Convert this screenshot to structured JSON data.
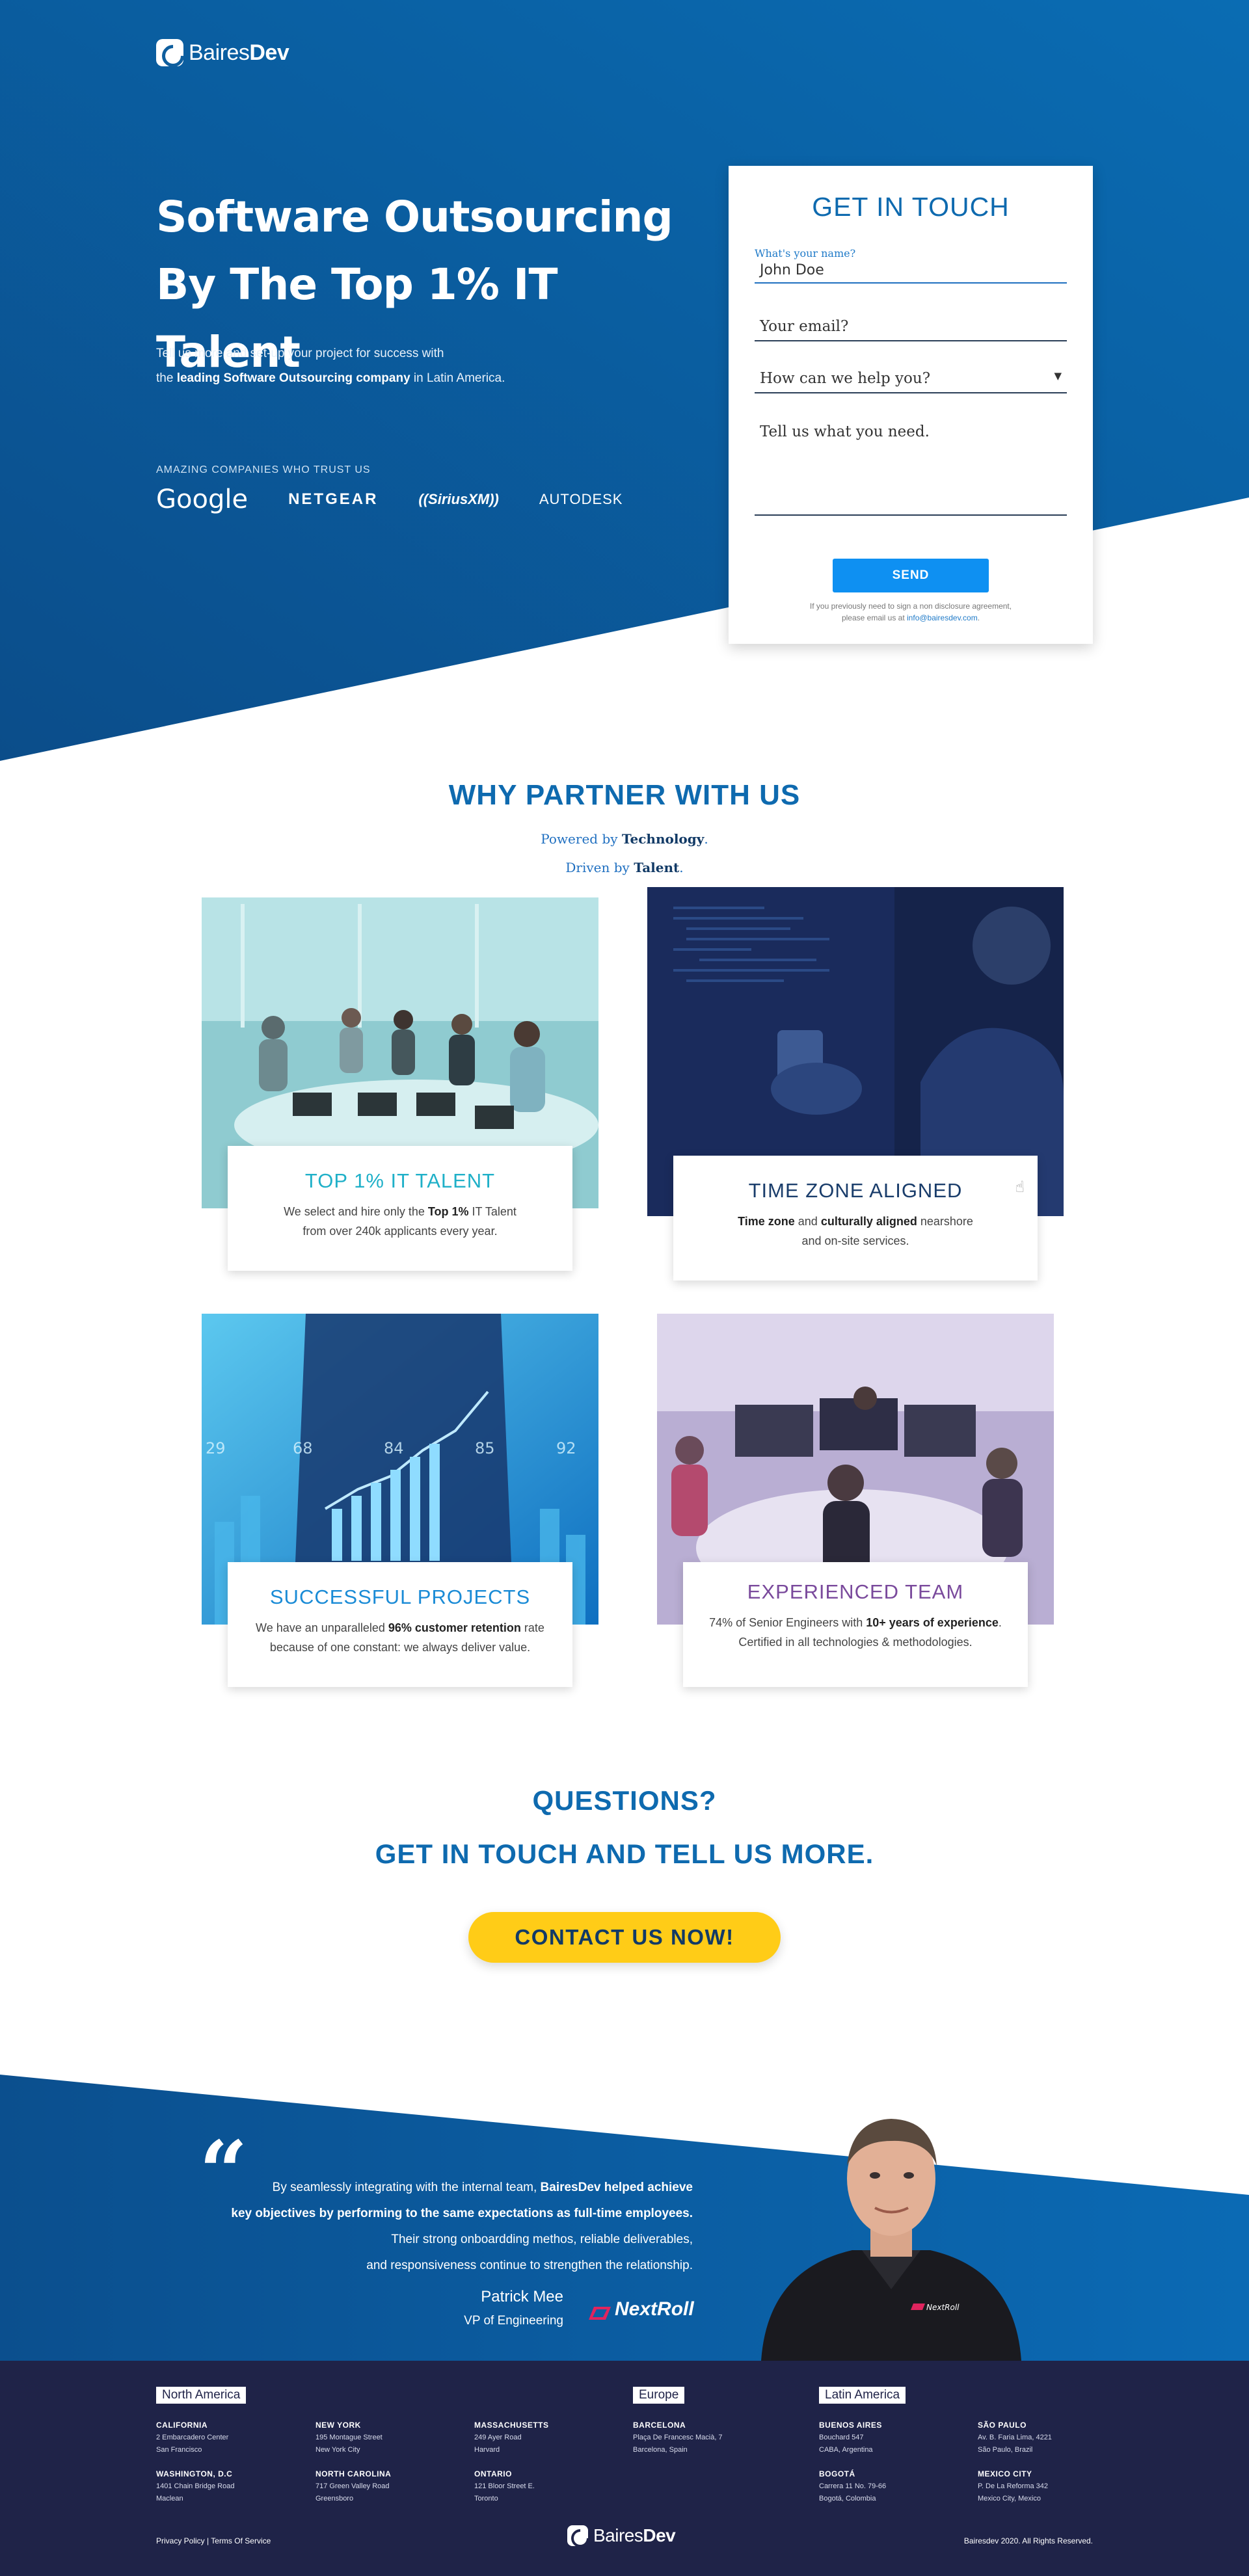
{
  "brand": {
    "name_light": "Baires",
    "name_bold": "Dev"
  },
  "hero": {
    "title_line1": "Software Outsourcing",
    "title_line2": "By The Top 1% IT Talent",
    "sub_line1": "Tell us more and set-up your project for success with",
    "sub_pre": "the ",
    "sub_bold": "leading Software Outsourcing company",
    "sub_post": " in Latin America.",
    "trust_label": "AMAZING COMPANIES WHO TRUST US",
    "trust_logos": [
      "Google",
      "NETGEAR",
      "((SiriusXM))",
      "AUTODESK"
    ]
  },
  "form": {
    "title": "GET IN TOUCH",
    "name_label": "What's your name?",
    "name_value": "John Doe",
    "email_placeholder": "Your email?",
    "help_placeholder": "How can we help you?",
    "help_arrow": "▼",
    "message_placeholder": "Tell us what you need.",
    "send_label": "SEND",
    "note_line1": "If you previously need to sign a non disclosure agreement,",
    "note_pre": "please email us at ",
    "note_email": "info@bairesdev.com",
    "note_post": "."
  },
  "why": {
    "title": "WHY PARTNER WITH US",
    "line1_pre": "Powered by ",
    "line1_bold": "Technology",
    "line1_post": ".",
    "line2_pre": "Driven by ",
    "line2_bold": "Talent",
    "line2_post": "."
  },
  "cards": [
    {
      "title": "TOP 1% IT TALENT",
      "d1_pre": "We select and hire only the ",
      "d1_bold": "Top 1%",
      "d1_post": " IT Talent",
      "d2": "from over 240k applicants every year.",
      "color": "#1fb0c8"
    },
    {
      "title": "TIME ZONE ALIGNED",
      "d1_bold_a": "Time zone",
      "d1_mid": " and ",
      "d1_bold_b": "culturally aligned",
      "d1_post": " nearshore",
      "d2": "and on-site services.",
      "color": "#1a3d6b"
    },
    {
      "title": "SUCCESSFUL PROJECTS",
      "d1_pre": "We have an unparalleled ",
      "d1_bold": "96% customer retention",
      "d1_post": " rate",
      "d2": "because of one constant: we always deliver value.",
      "color": "#1a8bd6"
    },
    {
      "title": "EXPERIENCED TEAM",
      "d1_pre": "74% of Senior Engineers with ",
      "d1_bold": "10+ years of experience",
      "d1_post": ".",
      "d2": "Certified in all technologies & methodologies.",
      "color": "#7a4a9c"
    }
  ],
  "questions": {
    "line1": "QUESTIONS?",
    "line2": "GET IN TOUCH AND TELL US MORE.",
    "cta": "CONTACT US NOW!"
  },
  "testimonial": {
    "quote_mark": "“",
    "l1_pre": "By seamlessly integrating with the internal team, ",
    "l1_bold": "BairesDev helped achieve",
    "l2_bold": "key objectives by performing to the same expectations as full-time employees.",
    "l3": "Their strong onboardding methos, reliable deliverables,",
    "l4": "and responsiveness continue to strengthen the relationship.",
    "name": "Patrick Mee",
    "role": "VP of Engineering",
    "company": "NextRoll"
  },
  "footer": {
    "regions": {
      "na": "North America",
      "eu": "Europe",
      "la": "Latin America"
    },
    "offices": [
      {
        "city": "CALIFORNIA",
        "l1": "2 Embarcadero Center",
        "l2": "San Francisco"
      },
      {
        "city": "NEW YORK",
        "l1": "195 Montague Street",
        "l2": "New York City"
      },
      {
        "city": "MASSACHUSETTS",
        "l1": "249 Ayer Road",
        "l2": "Harvard"
      },
      {
        "city": "WASHINGTON, D.C",
        "l1": "1401 Chain Bridge Road",
        "l2": "Maclean"
      },
      {
        "city": "NORTH CAROLINA",
        "l1": "717 Green Valley Road",
        "l2": "Greensboro"
      },
      {
        "city": "ONTARIO",
        "l1": "121 Bloor Street E.",
        "l2": "Toronto"
      },
      {
        "city": "BARCELONA",
        "l1": "Plaça De Francesc Macià, 7",
        "l2": "Barcelona, Spain"
      },
      {
        "city": "BUENOS AIRES",
        "l1": "Bouchard 547",
        "l2": "CABA, Argentina"
      },
      {
        "city": "SÃO PAULO",
        "l1": "Av. B. Faria Lima, 4221",
        "l2": "São Paulo, Brazil"
      },
      {
        "city": "BOGOTÁ",
        "l1": "Carrera 11 No. 79-66",
        "l2": "Bogotá, Colombia"
      },
      {
        "city": "MEXICO CITY",
        "l1": "P. De La Reforma 342",
        "l2": "Mexico City, Mexico"
      }
    ],
    "privacy": "Privacy Policy",
    "sep": " | ",
    "terms": "Terms Of Service",
    "copyright": "Bairesdev 2020.  All Rights Reserved."
  },
  "colors": {
    "brand_blue": "#0e6aaf",
    "cta_yellow": "#ffcc17",
    "footer_navy": "#1f2348",
    "send_blue": "#0e90f2"
  }
}
